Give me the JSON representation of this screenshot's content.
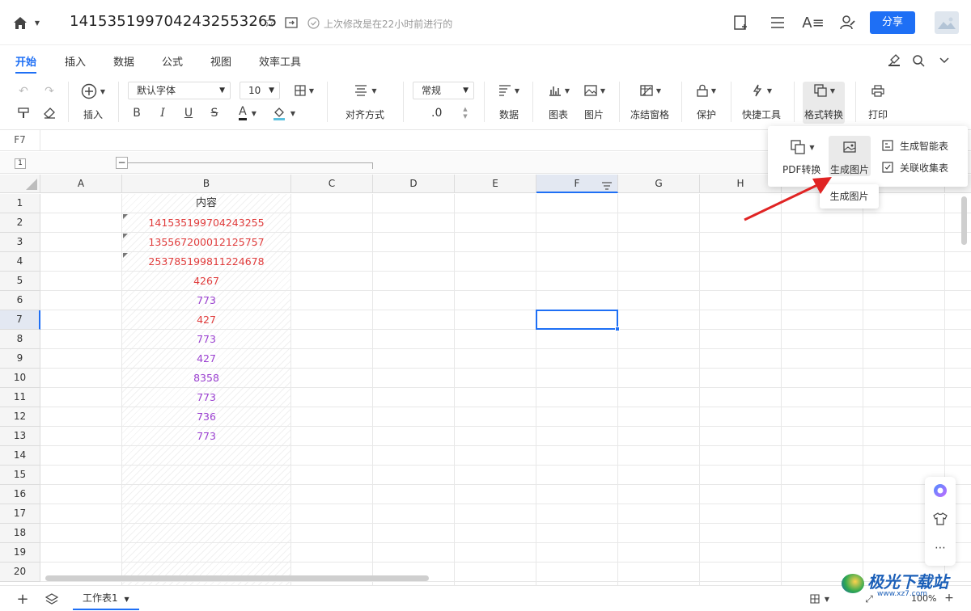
{
  "doc": {
    "title": "1415351997042432553265",
    "last_modified": "上次修改是在22小时前进行的",
    "share": "分享"
  },
  "tabs": [
    "开始",
    "插入",
    "数据",
    "公式",
    "视图",
    "效率工具"
  ],
  "toolbar": {
    "insert": "插入",
    "font": "默认字体",
    "font_size": "10",
    "bold": "B",
    "italic": "I",
    "underline": "U",
    "strike": "S",
    "font_color": "A",
    "align": "对齐方式",
    "number_format": "常规",
    "decimal": ".0",
    "data": "数据",
    "chart": "图表",
    "picture": "图片",
    "freeze": "冻结窗格",
    "protect": "保护",
    "quick_tools": "快捷工具",
    "format_convert": "格式转换",
    "print": "打印"
  },
  "formula_bar": {
    "cell_ref": "F7"
  },
  "group_level": "1",
  "dropdown": {
    "pdf": "PDF转换",
    "gen_image": "生成图片",
    "gen_smart_table": "生成智能表",
    "link_collect": "关联收集表",
    "tooltip": "生成图片"
  },
  "columns": [
    "A",
    "B",
    "C",
    "D",
    "E",
    "F",
    "G",
    "H"
  ],
  "rows": [
    "1",
    "2",
    "3",
    "4",
    "5",
    "6",
    "7",
    "8",
    "9",
    "10",
    "11",
    "12",
    "13",
    "14",
    "15",
    "16",
    "17",
    "18",
    "19",
    "20"
  ],
  "cells_b": [
    {
      "text": "内容",
      "color": "#333333"
    },
    {
      "text": "141535199704243255",
      "color": "#e03c3c"
    },
    {
      "text": "135567200012125757",
      "color": "#e03c3c"
    },
    {
      "text": "253785199811224678",
      "color": "#e03c3c"
    },
    {
      "text": "4267",
      "color": "#e03c3c"
    },
    {
      "text": "773",
      "color": "#9a3fd0"
    },
    {
      "text": "427",
      "color": "#e03c3c"
    },
    {
      "text": "773",
      "color": "#9a3fd0"
    },
    {
      "text": "427",
      "color": "#9a3fd0"
    },
    {
      "text": "8358",
      "color": "#9a3fd0"
    },
    {
      "text": "773",
      "color": "#9a3fd0"
    },
    {
      "text": "736",
      "color": "#9a3fd0"
    },
    {
      "text": "773",
      "color": "#9a3fd0"
    }
  ],
  "bottom": {
    "sheet_name": "工作表1",
    "zoom": "100%"
  },
  "watermark": {
    "main": "极光下载站",
    "sub": "www.xz7.com"
  },
  "colors": {
    "accent": "#1e6ff5",
    "red_text": "#e03c3c",
    "purple_text": "#9a3fd0"
  }
}
